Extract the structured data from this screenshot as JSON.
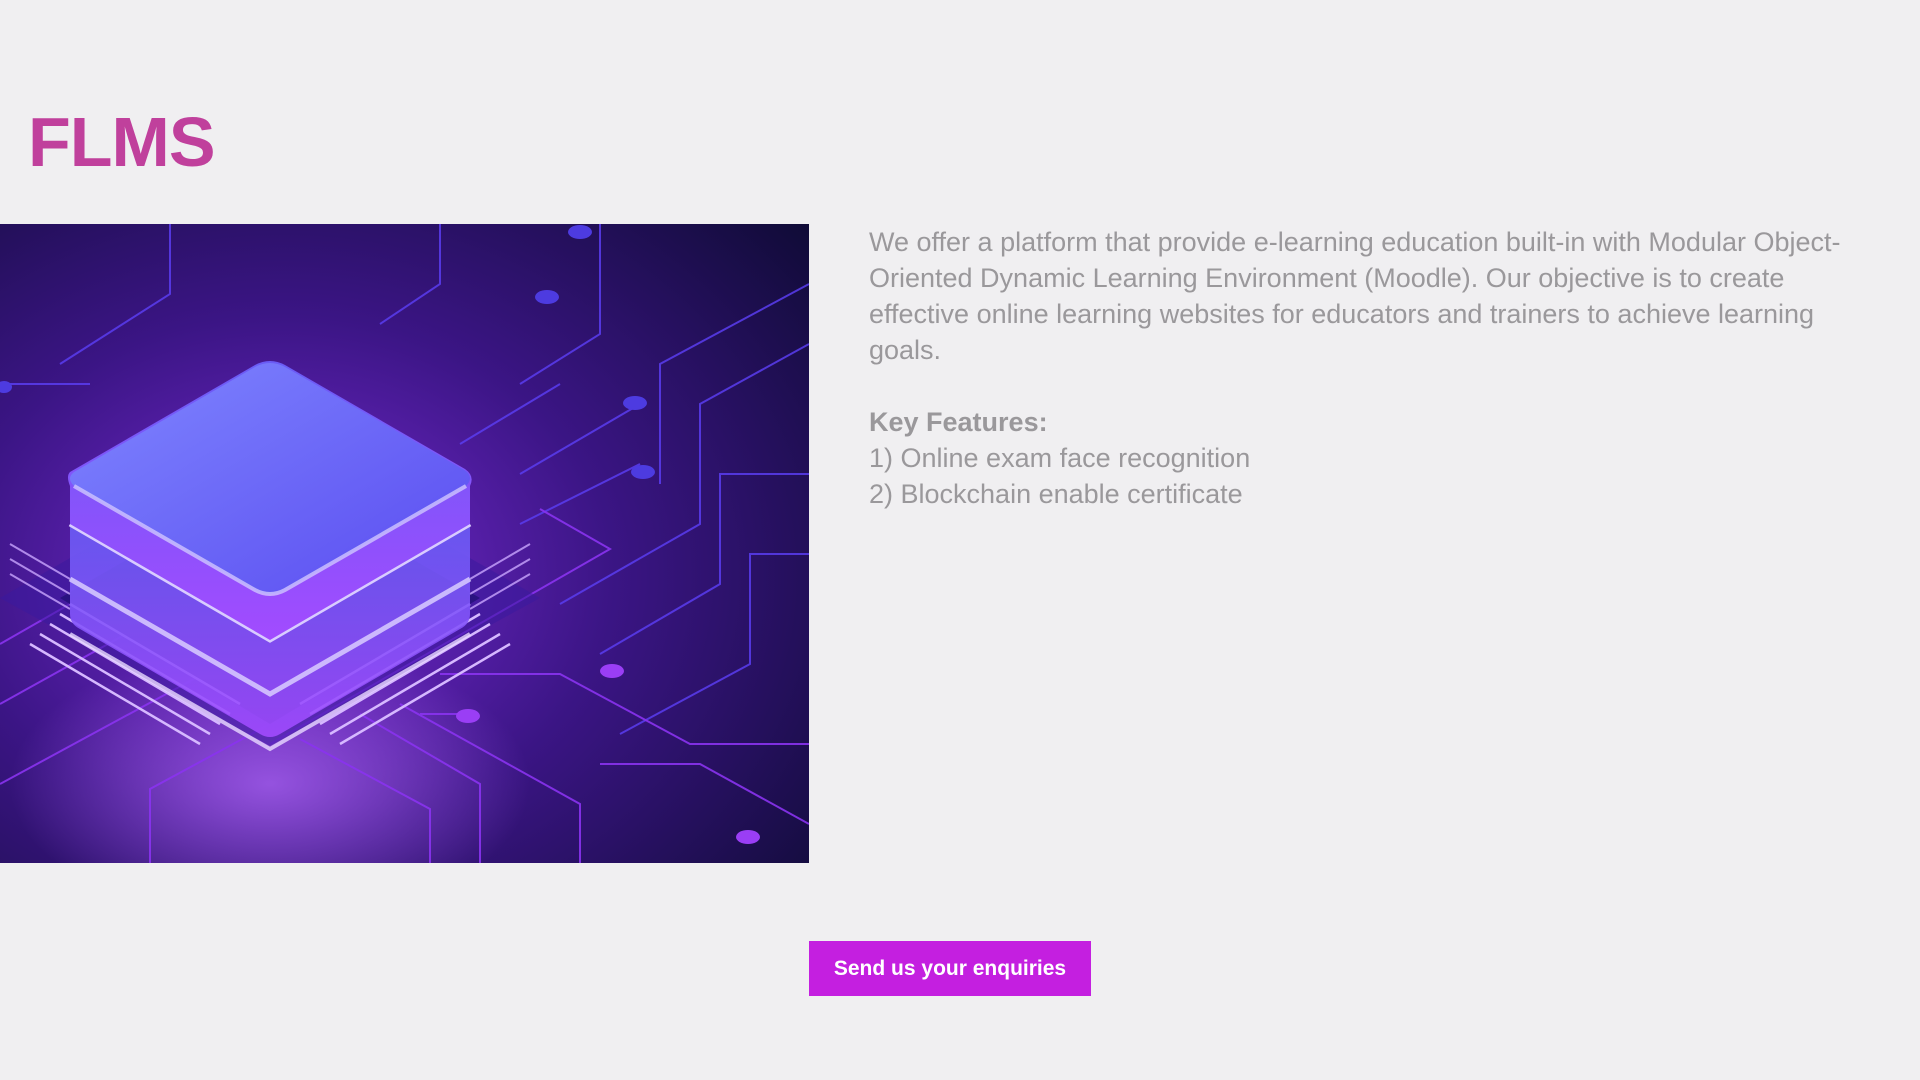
{
  "header": {
    "title": "FLMS",
    "title_color": "#c0409c"
  },
  "hero": {
    "image_icon": "isometric-server-chip-illustration"
  },
  "intro": {
    "text": "We offer a platform that provide e-learning education built-in with Modular Object-Oriented Dynamic Learning Environment (Moodle). Our objective is to create effective online learning websites for educators and trainers to achieve learning goals."
  },
  "features": {
    "heading": "Key Features:",
    "items": [
      "1) Online exam face recognition",
      "2) Blockchain enable certificate"
    ]
  },
  "cta": {
    "label": "Send us your enquiries",
    "color": "#c41fe0"
  }
}
